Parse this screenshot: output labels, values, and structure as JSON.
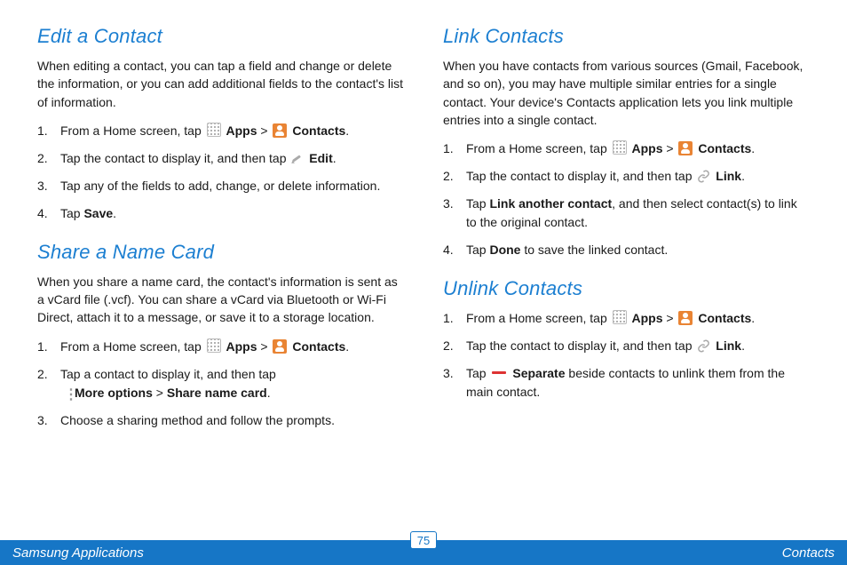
{
  "left": {
    "sect1": {
      "heading": "Edit a Contact",
      "intro": "When editing a contact, you can tap a field and change or delete the information, or you can add additional fields to the contact's list of information.",
      "steps": {
        "s1a": "From a Home screen, tap ",
        "s1_apps": "Apps",
        "s1_gt": " > ",
        "s1_contacts": "Contacts",
        "s1_end": ".",
        "s2a": "Tap the contact to display it, and then tap ",
        "s2_edit": "Edit",
        "s2_end": ".",
        "s3": "Tap any of the fields to add, change, or delete information.",
        "s4a": "Tap ",
        "s4_save": "Save",
        "s4_end": "."
      }
    },
    "sect2": {
      "heading": "Share a Name Card",
      "intro": "When you share a name card, the contact's information is sent as a vCard file (.vcf). You can share a vCard via Bluetooth or Wi-Fi Direct, attach it to a message, or save it to a storage location.",
      "steps": {
        "s1a": "From a Home screen, tap ",
        "s1_apps": "Apps",
        "s1_gt": " > ",
        "s1_contacts": "Contacts",
        "s1_end": ".",
        "s2a": "Tap a contact to display it, and then tap ",
        "s2_more": "More options",
        "s2_gt": " > ",
        "s2_share": "Share name card",
        "s2_end": ".",
        "s3": "Choose a sharing method and follow the prompts."
      }
    }
  },
  "right": {
    "sect1": {
      "heading": "Link Contacts",
      "intro": "When you have contacts from various sources (Gmail, Facebook, and so on), you may have multiple similar entries for a single contact. Your device's Contacts application lets you link multiple entries into a single contact.",
      "steps": {
        "s1a": "From a Home screen, tap ",
        "s1_apps": "Apps",
        "s1_gt": " > ",
        "s1_contacts": "Contacts",
        "s1_end": ".",
        "s2a": "Tap the contact to display it, and then tap ",
        "s2_link": "Link",
        "s2_end": ".",
        "s3a": "Tap ",
        "s3_lac": "Link another contact",
        "s3b": ", and then select contact(s) to link to the original contact.",
        "s4a": "Tap ",
        "s4_done": "Done",
        "s4b": " to save the linked contact."
      }
    },
    "sect2": {
      "heading": "Unlink Contacts",
      "steps": {
        "s1a": "From a Home screen, tap ",
        "s1_apps": "Apps",
        "s1_gt": " > ",
        "s1_contacts": "Contacts",
        "s1_end": ".",
        "s2a": "Tap the contact to display it, and then tap ",
        "s2_link": "Link",
        "s2_end": ".",
        "s3a": "Tap ",
        "s3_sep": "Separate",
        "s3b": " beside contacts to unlink them from the main contact."
      }
    }
  },
  "footer": {
    "left": "Samsung Applications",
    "page": "75",
    "right": "Contacts"
  }
}
